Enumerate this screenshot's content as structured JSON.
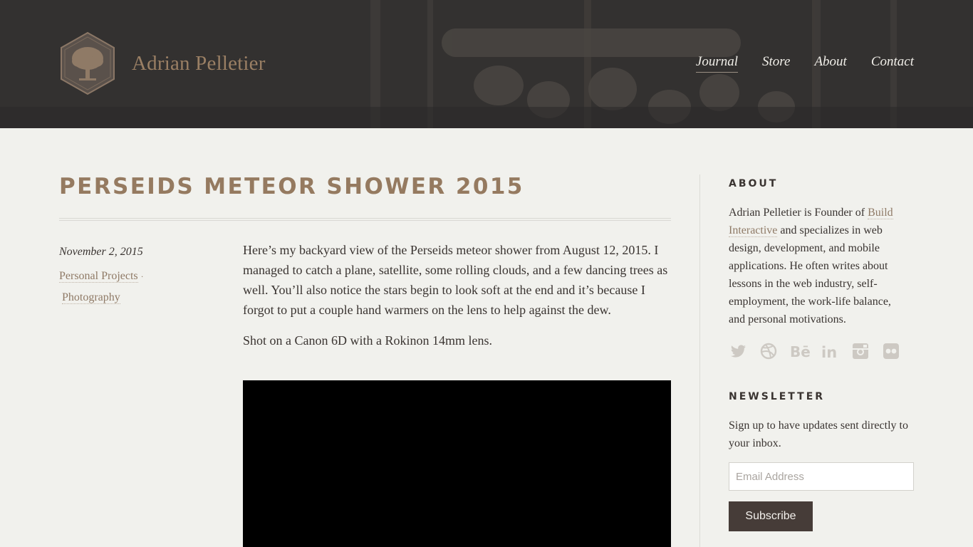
{
  "header": {
    "site_title": "Adrian Pelletier",
    "nav": [
      {
        "label": "Journal",
        "active": true
      },
      {
        "label": "Store",
        "active": false
      },
      {
        "label": "About",
        "active": false
      },
      {
        "label": "Contact",
        "active": false
      }
    ]
  },
  "post": {
    "title": "PERSEIDS METEOR SHOWER 2015",
    "date": "November 2, 2015",
    "categories": [
      "Personal Projects",
      "Photography"
    ],
    "category_separator": "·",
    "paragraphs": [
      "Here’s my backyard view of the Perseids meteor shower from August 12, 2015. I managed to catch a plane, satellite, some rolling clouds, and a few dancing trees as well. You’ll also notice the stars begin to look soft at the end and it’s because I forgot to put a couple hand warmers on the lens to help against the dew.",
      "Shot on a Canon 6D with a Rokinon 14mm lens."
    ]
  },
  "sidebar": {
    "about": {
      "title": "ABOUT",
      "text_before": "Adrian Pelletier is Founder of ",
      "link": "Build Interactive",
      "text_after": " and specializes in web design, development, and mobile applications. He often writes about lessons in the web industry, self-employment, the work-life balance, and personal motivations."
    },
    "social_icons": [
      "twitter-icon",
      "dribbble-icon",
      "behance-icon",
      "linkedin-icon",
      "instagram-icon",
      "flickr-icon"
    ],
    "newsletter": {
      "title": "NEWSLETTER",
      "text": "Sign up to have updates sent directly to your inbox.",
      "email_placeholder": "Email Address",
      "email_value": "",
      "button_label": "Subscribe"
    }
  },
  "colors": {
    "accent": "#957a60",
    "link": "#8f7a66",
    "header_bg": "#333130",
    "page_bg": "#f1f1ed",
    "button_bg": "#463c38"
  }
}
